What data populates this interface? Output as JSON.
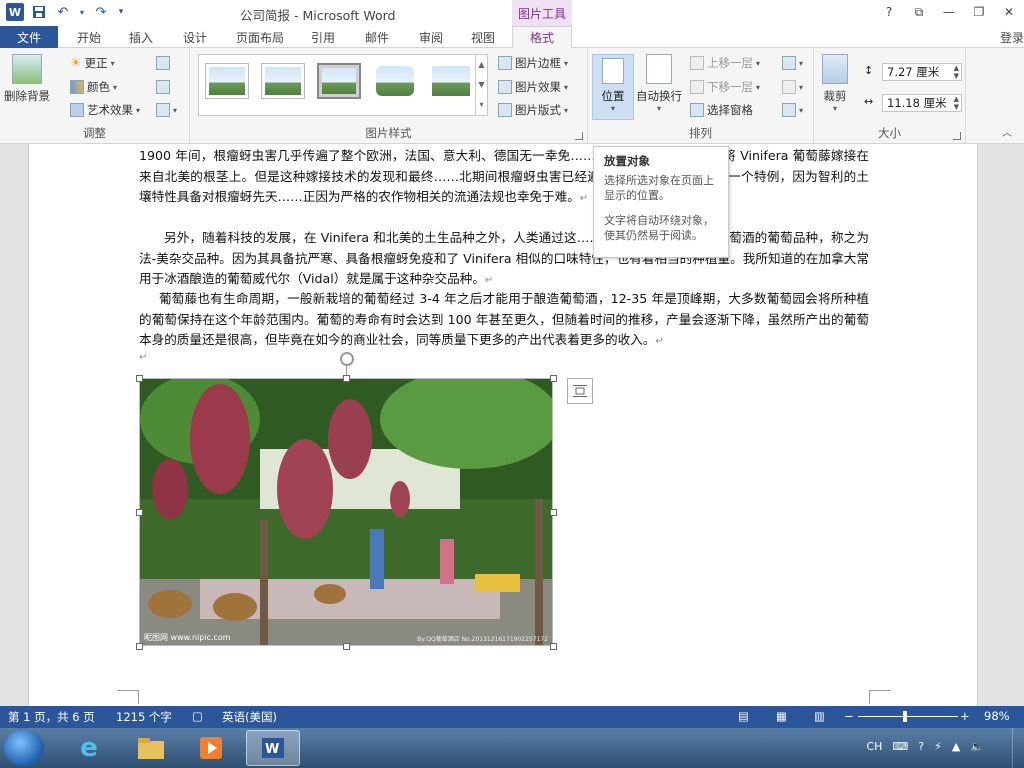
{
  "window": {
    "title": "公司简报 - Microsoft Word",
    "context_tab_group": "图片工具",
    "login": "登录",
    "help": "?",
    "app_icon": "W"
  },
  "tabs": [
    "文件",
    "开始",
    "插入",
    "设计",
    "页面布局",
    "引用",
    "邮件",
    "审阅",
    "视图",
    "格式"
  ],
  "ribbon": {
    "adjust": {
      "label": "调整",
      "remove_bg": "删除背景",
      "corrections": "更正",
      "color": "颜色",
      "artistic": "艺术效果"
    },
    "styles": {
      "label": "图片样式",
      "border": "图片边框",
      "effects": "图片效果",
      "layout": "图片版式"
    },
    "arrange": {
      "label": "排列",
      "position": "位置",
      "wrap_text": "自动换行",
      "bring_forward": "上移一层",
      "send_backward": "下移一层",
      "selection_pane": "选择窗格"
    },
    "size": {
      "label": "大小",
      "crop": "裁剪",
      "height": "7.27 厘米",
      "width": "11.18 厘米"
    }
  },
  "tooltip": {
    "title": "放置对象",
    "line1": "选择所选对象在页面上显示的位置。",
    "line2": "文字将自动环绕对象，使其仍然易于阅读。"
  },
  "document": {
    "p1": "1900 年间，根瘤蚜虫害几乎传遍了整个欧洲，法国、意大利、德国无一幸免……找到了解决方案，就是将 Vinifera 葡萄藤嫁接在来自北美的根茎上。但是这种嫁接技术的发现和最终……北期间根瘤蚜虫害已经遍布了世界各地。智利是一个特例，因为智利的土壤特性具备对根瘤蚜先天……正因为严格的农作物相关的流通法规也幸免于难。",
    "p2": "另外，随着科技的发展，在 Vinifera 和北美的土生品种之外，人类通过这……第三种可以用以酿造葡萄酒的葡萄品种，称之为法-美杂交品种。因为其具备抗严寒、具备根瘤蚜免疫和了 Vinifera 相似的口味特性，也有着相当的种植量。我所知道的在加拿大常用于冰酒酿造的葡萄威代尔（Vidal）就是属于这种杂交品种。",
    "p3": "葡萄藤也有生命周期，一般新栽培的葡萄经过 3-4 年之后才能用于酿造葡萄酒，12-35 年是顶峰期，大多数葡萄园会将所种植的葡萄保持在这个年龄范围内。葡萄的寿命有时会达到 100 年甚至更久，但随着时间的推移，产量会逐渐下降，虽然所产出的葡萄本身的质量还是很高，但毕竟在如今的商业社会，同等质量下更多的产出代表着更多的收入。",
    "photo_watermark_left": "昵图网 www.nipic.com",
    "photo_watermark_right": "By:QQ葡萄酒店 No.20131216171902257172"
  },
  "status": {
    "page": "第 1 页，共 6 页",
    "words": "1215 个字",
    "language": "英语(美国)",
    "zoom": "98%"
  },
  "taskbar": {
    "tray_lang": "CH"
  }
}
